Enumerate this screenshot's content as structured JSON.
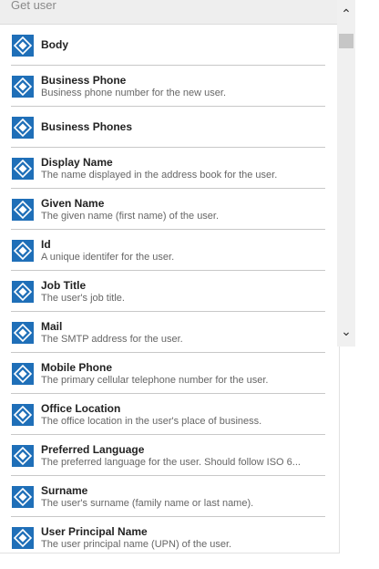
{
  "header": {
    "title": "Get user"
  },
  "items": [
    {
      "title": "Body",
      "desc": ""
    },
    {
      "title": "Business Phone",
      "desc": "Business phone number for the new user."
    },
    {
      "title": "Business Phones",
      "desc": ""
    },
    {
      "title": "Display Name",
      "desc": "The name displayed in the address book for the user."
    },
    {
      "title": "Given Name",
      "desc": "The given name (first name) of the user."
    },
    {
      "title": "Id",
      "desc": "A unique identifer for the user."
    },
    {
      "title": "Job Title",
      "desc": "The user's job title."
    },
    {
      "title": "Mail",
      "desc": "The SMTP address for the user."
    },
    {
      "title": "Mobile Phone",
      "desc": "The primary cellular telephone number for the user."
    },
    {
      "title": "Office Location",
      "desc": "The office location in the user's place of business."
    },
    {
      "title": "Preferred Language",
      "desc": "The preferred language for the user. Should follow ISO 6..."
    },
    {
      "title": "Surname",
      "desc": "The user's surname (family name or last name)."
    },
    {
      "title": "User Principal Name",
      "desc": "The user principal name (UPN) of the user."
    }
  ],
  "icons": {
    "item_icon": "dynamic-content-icon",
    "scroll_up": "chevron-up-icon",
    "scroll_down": "chevron-down-icon"
  },
  "colors": {
    "icon_bg": "#1f6fb8",
    "header_bg": "#eeeeee"
  }
}
